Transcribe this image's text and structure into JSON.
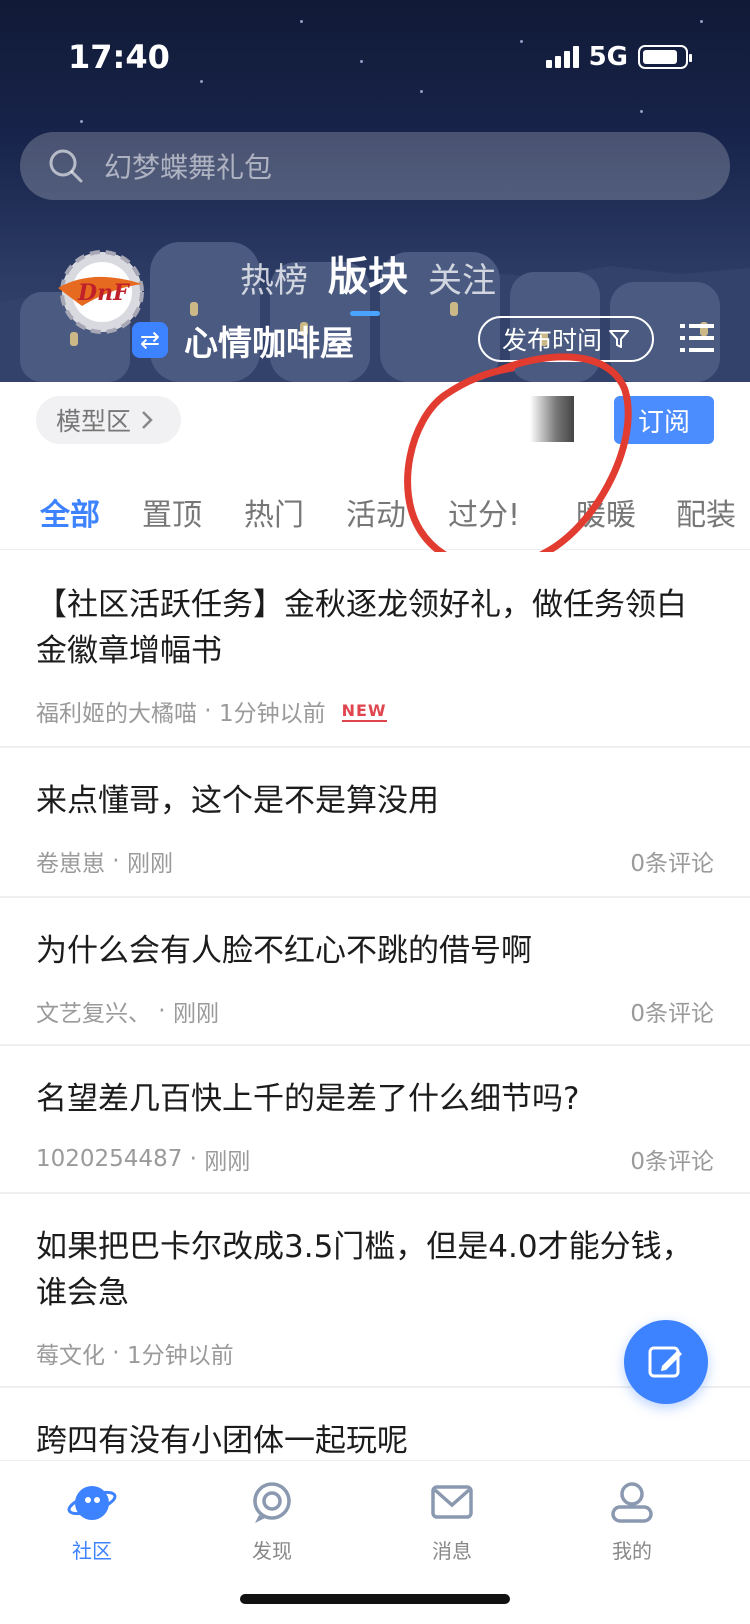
{
  "status_bar": {
    "time": "17:40",
    "network": "5G",
    "battery_level": 0.85
  },
  "search": {
    "placeholder": "幻梦蝶舞礼包"
  },
  "top_tabs": [
    {
      "label": "热榜",
      "active": false
    },
    {
      "label": "版块",
      "active": true
    },
    {
      "label": "关注",
      "active": false
    }
  ],
  "board": {
    "name": "心情咖啡屋",
    "sort_label": "发布时间"
  },
  "sub_header": {
    "zone_label": "模型区",
    "subscribe_label": "订阅"
  },
  "categories": [
    "全部",
    "置顶",
    "热门",
    "活动",
    "过分!",
    "暖暖",
    "配装"
  ],
  "posts": [
    {
      "title": "【社区活跃任务】金秋逐龙领好礼，做任务领白金徽章增幅书",
      "author": "福利姬的大橘喵",
      "time": "1分钟以前",
      "badge": "NEW",
      "comments": ""
    },
    {
      "title": "来点懂哥，这个是不是算没用",
      "author": "卷崽崽",
      "time": "刚刚",
      "badge": "",
      "comments": "0条评论"
    },
    {
      "title": "为什么会有人脸不红心不跳的借号啊",
      "author": "文艺复兴、",
      "time": "刚刚",
      "badge": "",
      "comments": "0条评论"
    },
    {
      "title": "名望差几百快上千的是差了什么细节吗?",
      "author": "1020254487",
      "time": "刚刚",
      "badge": "",
      "comments": "0条评论"
    },
    {
      "title": "如果把巴卡尔改成3.5门槛，但是4.0才能分钱，谁会急",
      "author": "莓文化",
      "time": "1分钟以前",
      "badge": "",
      "comments": ""
    },
    {
      "title": "跨四有没有小团体一起玩呢",
      "author": "",
      "time": "",
      "badge": "",
      "comments": ""
    }
  ],
  "bottom_nav": [
    {
      "label": "社区",
      "active": true
    },
    {
      "label": "发现",
      "active": false
    },
    {
      "label": "消息",
      "active": false
    },
    {
      "label": "我的",
      "active": false
    }
  ],
  "colors": {
    "accent": "#3d82ff",
    "annotation": "#e23b30",
    "new_badge": "#e0454f"
  },
  "icons": {
    "search": "search-icon",
    "switch": "swap-icon",
    "filter": "filter-icon",
    "menu": "list-menu-icon",
    "chevron": "chevron-right-icon",
    "compose": "edit-icon"
  }
}
